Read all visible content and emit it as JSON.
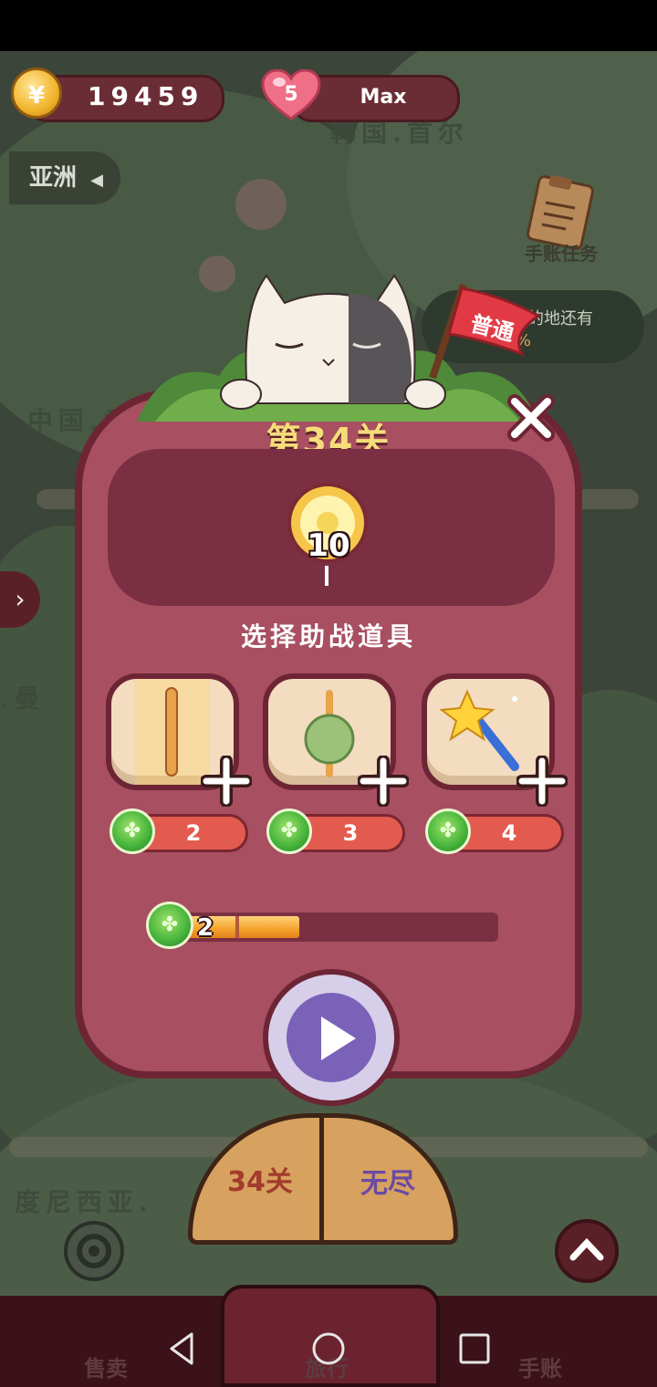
{
  "hud": {
    "coins": "19459",
    "coin_symbol": "¥",
    "lives": "5",
    "lives_status": "Max"
  },
  "map": {
    "region_tab": "亚洲",
    "labels": [
      "韩国.首尔",
      "中国.香",
      "度尼西亚.",
      ".曼"
    ],
    "journal_label": "手账任务",
    "progress_text": "全目的地还有",
    "progress_pct": "19%"
  },
  "dialog": {
    "difficulty": "普通",
    "level_title": "第34关",
    "goal_count": "10",
    "choose_label": "选择助战道具",
    "items": [
      {
        "name": "rocket-stick",
        "price": "2"
      },
      {
        "name": "matcha-ball",
        "price": "3"
      },
      {
        "name": "magic-wand",
        "price": "4"
      }
    ],
    "energy_count": "2",
    "energy_fill_ratio": 0.37
  },
  "mode_board": {
    "left": "34关",
    "right": "无尽"
  },
  "bottom_tabs": {
    "left": "售卖",
    "center": "旅行",
    "right": "手账"
  },
  "colors": {
    "dialog_bg": "#a84f62",
    "dialog_border": "#6d2535",
    "price_red": "#e35b4f",
    "play_purple": "#7a62b8",
    "title_gold": "#f5dd7a"
  }
}
